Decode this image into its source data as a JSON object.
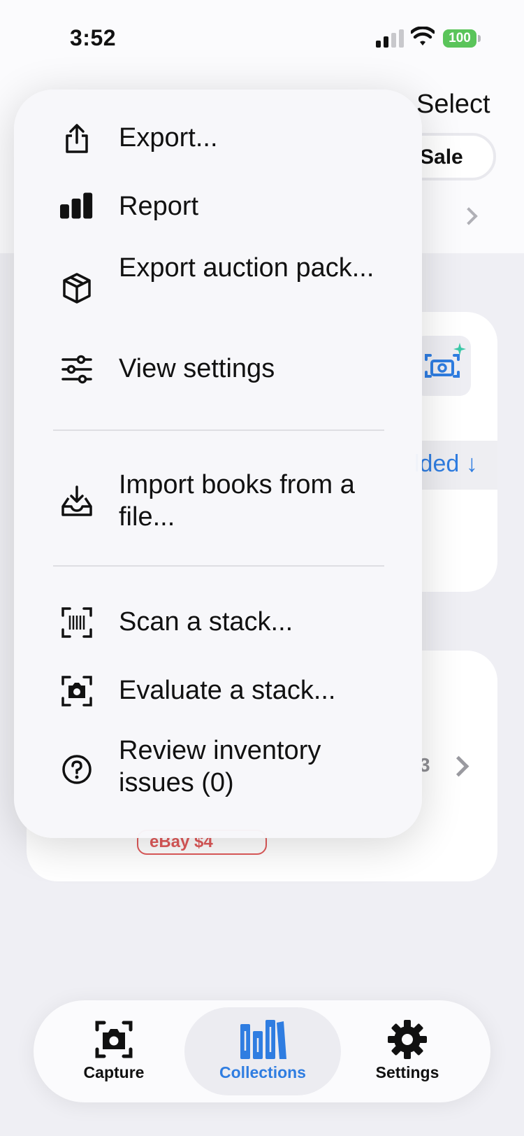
{
  "status": {
    "time": "3:52",
    "battery": "100"
  },
  "background": {
    "select_label": "Select",
    "sale_label": "Sale",
    "sort_label": "lded ↓",
    "item_count": "3",
    "ebay_badge": "eBay $4"
  },
  "menu": {
    "items": [
      {
        "label": "Export...",
        "icon": "share-icon"
      },
      {
        "label": "Report",
        "icon": "bar-chart-icon"
      },
      {
        "label": "Export auction pack...",
        "icon": "package-icon"
      },
      {
        "label": "View settings",
        "icon": "sliders-icon"
      },
      {
        "label": "Import books from a file...",
        "icon": "tray-download-icon"
      },
      {
        "label": "Scan a stack...",
        "icon": "barcode-scan-icon"
      },
      {
        "label": "Evaluate a stack...",
        "icon": "camera-scan-icon"
      },
      {
        "label": "Review inventory issues (0)",
        "icon": "question-circle-icon"
      }
    ]
  },
  "tabbar": {
    "tabs": [
      {
        "label": "Capture",
        "icon": "camera-icon",
        "active": false
      },
      {
        "label": "Collections",
        "icon": "books-icon",
        "active": true
      },
      {
        "label": "Settings",
        "icon": "gear-icon",
        "active": false
      }
    ],
    "active_color": "#2f7de1"
  }
}
